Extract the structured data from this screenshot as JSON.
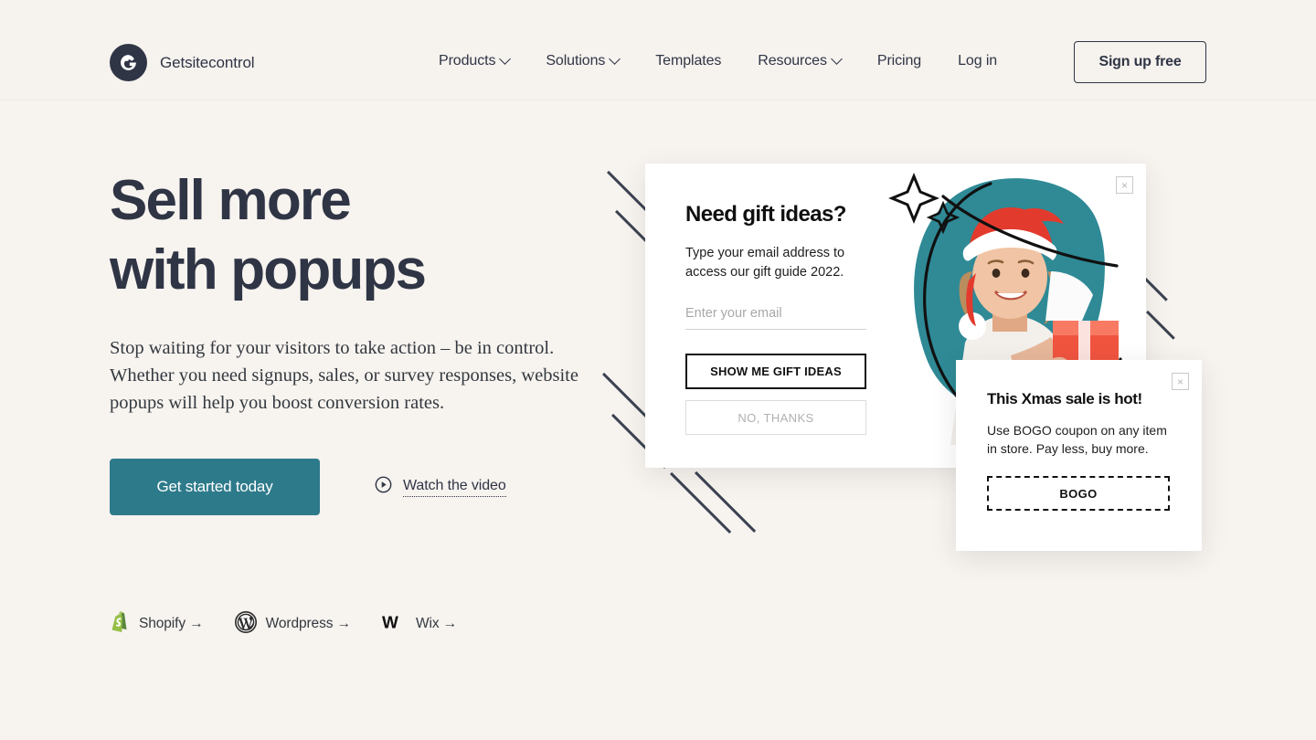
{
  "theme": {
    "page_bg": "#f7f3ef",
    "header_bg": "#f6f2ee",
    "ink": "#2f3545",
    "accent_teal": "#2d7a8b",
    "popup_bg": "#ffffff",
    "blob_teal": "#2f8a96",
    "gift_red": "#f0543f"
  },
  "header": {
    "brand": {
      "name": "Getsitecontrol",
      "logo_icon": "getsitecontrol-logo-icon"
    },
    "nav": [
      {
        "label": "Products",
        "has_dropdown": true
      },
      {
        "label": "Solutions",
        "has_dropdown": true
      },
      {
        "label": "Templates",
        "has_dropdown": false
      },
      {
        "label": "Resources",
        "has_dropdown": true
      },
      {
        "label": "Pricing",
        "has_dropdown": false
      },
      {
        "label": "Log in",
        "has_dropdown": false
      }
    ],
    "signup_label": "Sign up free"
  },
  "hero": {
    "title_line1": "Sell more",
    "title_line2": "with popups",
    "subtitle": "Stop waiting for your visitors to take action – be in control. Whether you need signups, sales, or survey responses, website popups will help you boost conversion rates.",
    "cta_primary": "Get started today",
    "cta_video": "Watch the video",
    "play_icon": "play-circle-icon"
  },
  "integrations": [
    {
      "label": "Shopify →",
      "icon": "shopify-icon"
    },
    {
      "label": "Wordpress →",
      "icon": "wordpress-icon"
    },
    {
      "label": "Wix →",
      "icon": "wix-icon"
    }
  ],
  "popup_email": {
    "title": "Need gift ideas?",
    "text": "Type your email address to access our gift guide 2022.",
    "input_placeholder": "Enter your email",
    "input_value": "",
    "primary_button": "SHOW ME GIFT IDEAS",
    "secondary_button": "NO, THANKS",
    "close_label": "×",
    "close_icon": "close-icon"
  },
  "popup_xmas": {
    "title": "This Xmas sale is hot!",
    "text": "Use BOGO coupon on any item in store. Pay less, buy more.",
    "coupon_code": "BOGO",
    "close_label": "×",
    "close_icon": "close-icon"
  }
}
